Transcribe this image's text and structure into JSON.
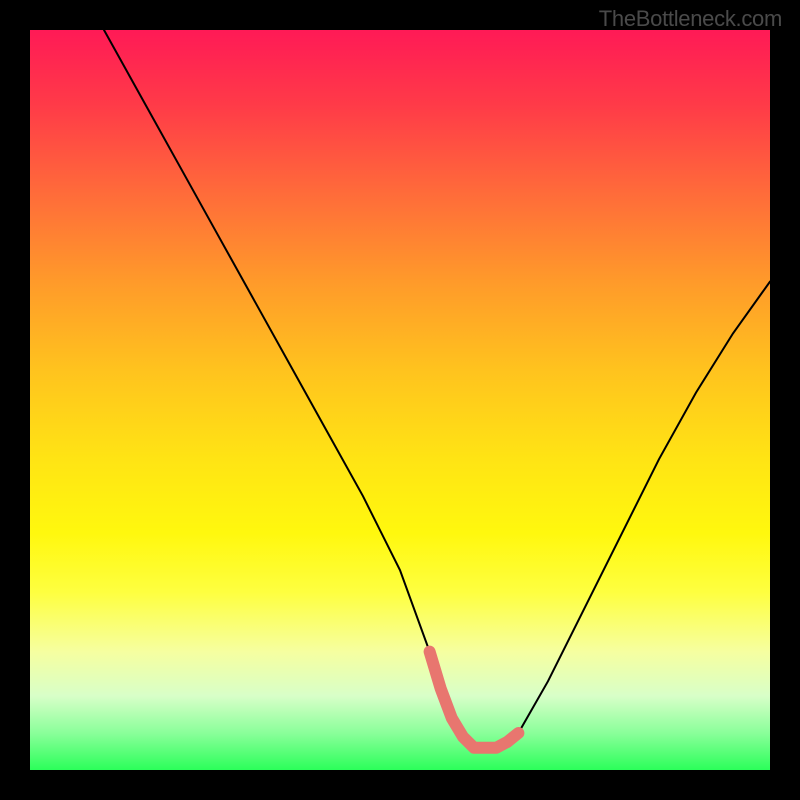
{
  "watermark": "TheBottleneck.com",
  "chart_data": {
    "type": "line",
    "title": "",
    "xlabel": "",
    "ylabel": "",
    "xlim": [
      0,
      100
    ],
    "ylim": [
      0,
      100
    ],
    "series": [
      {
        "name": "bottleneck-curve",
        "x": [
          10,
          15,
          20,
          25,
          30,
          35,
          40,
          45,
          50,
          54,
          57,
          60,
          63,
          66,
          70,
          75,
          80,
          85,
          90,
          95,
          100
        ],
        "y": [
          100,
          91,
          82,
          73,
          64,
          55,
          46,
          37,
          27,
          16,
          7,
          3,
          3,
          5,
          12,
          22,
          32,
          42,
          51,
          59,
          66
        ]
      }
    ],
    "highlight": {
      "name": "optimal-range",
      "x": [
        54,
        55.5,
        57,
        58.5,
        60,
        61.5,
        63,
        64.5,
        66
      ],
      "y": [
        16,
        11,
        7,
        4.5,
        3,
        3,
        3,
        3.8,
        5
      ]
    },
    "colors": {
      "gradient_top": "#ff1a56",
      "gradient_mid": "#ffe414",
      "gradient_bottom": "#2bff5a",
      "curve": "#000000",
      "highlight": "#e8766f"
    }
  }
}
